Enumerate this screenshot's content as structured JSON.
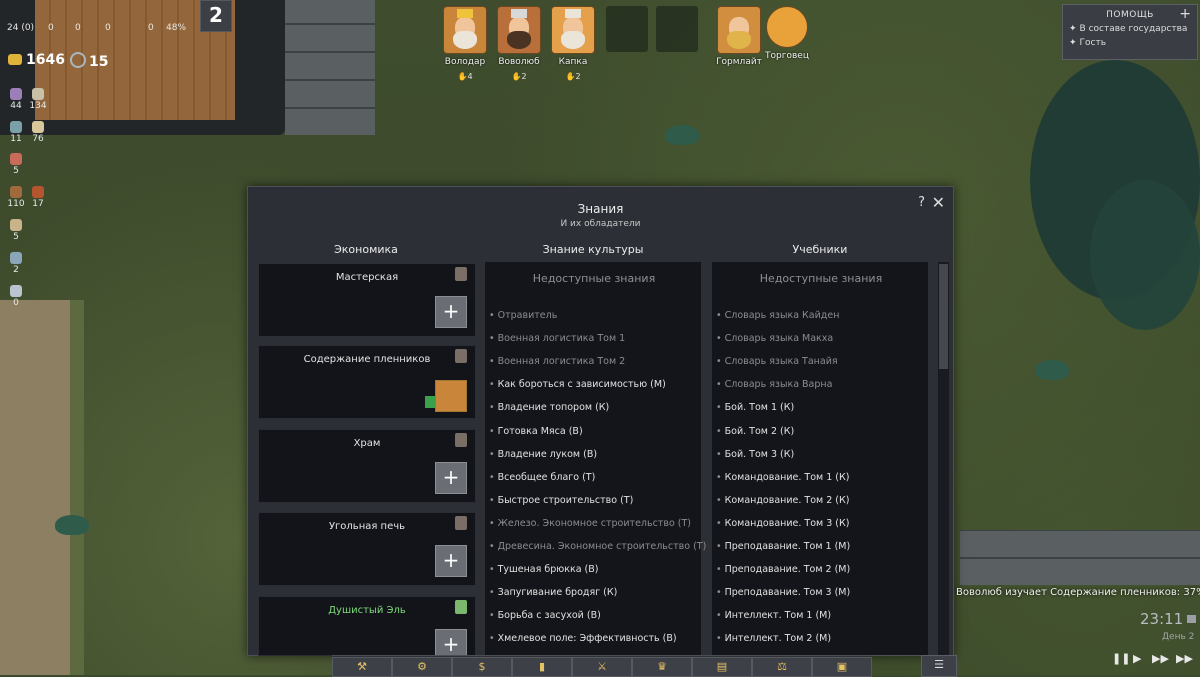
{
  "hud": {
    "top_counts": [
      "24 (0)",
      "0",
      "0",
      "0",
      "0",
      "0"
    ],
    "percent": "48%",
    "day_number": "2",
    "gold": "1646",
    "secondary": "15",
    "resources": [
      "44",
      "134",
      "11",
      "76",
      "5",
      "110",
      "17",
      "5",
      "2",
      "0"
    ]
  },
  "characters": [
    {
      "name": "Володар",
      "votes": "4"
    },
    {
      "name": "Воволюб",
      "votes": "2"
    },
    {
      "name": "Капка",
      "votes": "2"
    },
    {
      "name": "Гормлайт",
      "votes": ""
    },
    {
      "name": "Торговец",
      "votes": ""
    }
  ],
  "help_panel": {
    "title": "ПОМОЩЬ",
    "items": [
      "В составе государства",
      "Гость"
    ]
  },
  "dialog": {
    "title": "Знания",
    "subtitle": "И их обладатели",
    "columns": {
      "economy": "Экономика",
      "culture": "Знание культуры",
      "textbooks": "Учебники"
    },
    "economy_cards": [
      {
        "title": "Мастерская",
        "state": "add"
      },
      {
        "title": "Содержание пленников",
        "state": "assigned"
      },
      {
        "title": "Храм",
        "state": "add"
      },
      {
        "title": "Угольная печь",
        "state": "add"
      },
      {
        "title": "Душистый Эль",
        "state": "add",
        "highlight": true
      }
    ],
    "culture": {
      "header": "Недоступные знания",
      "items": [
        {
          "text": "Отравитель",
          "dim": true
        },
        {
          "text": "Военная логистика Том 1",
          "dim": true
        },
        {
          "text": "Военная логистика Том 2",
          "dim": true
        },
        {
          "text": "Как бороться с зависимостью (М)",
          "dim": false
        },
        {
          "text": "Владение топором  (К)",
          "dim": false
        },
        {
          "text": "Готовка Мяса  (В)",
          "dim": false
        },
        {
          "text": "Владение луком (В)",
          "dim": false
        },
        {
          "text": "Всеобщее благо (Т)",
          "dim": false
        },
        {
          "text": "Быстрое строительство (Т)",
          "dim": false
        },
        {
          "text": "Железо. Экономное строительство (Т)",
          "dim": true
        },
        {
          "text": "Древесина. Экономное строительство (Т)",
          "dim": true
        },
        {
          "text": "Тушеная брюкка  (В)",
          "dim": false
        },
        {
          "text": "Запугивание бродяг (К)",
          "dim": false
        },
        {
          "text": "Борьба с засухой (В)",
          "dim": false
        },
        {
          "text": "Хмелевое поле: Эффективность (В)",
          "dim": false
        }
      ]
    },
    "textbooks": {
      "header": "Недоступные знания",
      "items": [
        {
          "text": "Словарь языка Кайден",
          "dim": true
        },
        {
          "text": "Словарь языка Макха",
          "dim": true
        },
        {
          "text": "Словарь языка Танайя",
          "dim": true
        },
        {
          "text": "Словарь языка Варна",
          "dim": true
        },
        {
          "text": "Бой. Том 1 (К)",
          "dim": false
        },
        {
          "text": "Бой. Том 2 (К)",
          "dim": false
        },
        {
          "text": "Бой. Том 3 (К)",
          "dim": false
        },
        {
          "text": "Командование. Том 1 (К)",
          "dim": false
        },
        {
          "text": "Командование. Том 2 (К)",
          "dim": false
        },
        {
          "text": "Командование. Том 3 (К)",
          "dim": false
        },
        {
          "text": "Преподавание. Том 1 (М)",
          "dim": false
        },
        {
          "text": "Преподавание. Том 2 (М)",
          "dim": false
        },
        {
          "text": "Преподавание. Том 3 (М)",
          "dim": false
        },
        {
          "text": "Интеллект. Том 1 (М)",
          "dim": false
        },
        {
          "text": "Интеллект. Том 2 (М)",
          "dim": false
        }
      ]
    }
  },
  "notification": "Воволюб изучает Содержание пленников: 37%",
  "clock": {
    "time": "23:11",
    "day": "День 2"
  },
  "toolbar": [
    "hammer-icon",
    "gear-icon",
    "money-bag-icon",
    "stats-icon",
    "swords-icon",
    "crown-icon",
    "book-icon",
    "scales-icon",
    "map-icon"
  ]
}
